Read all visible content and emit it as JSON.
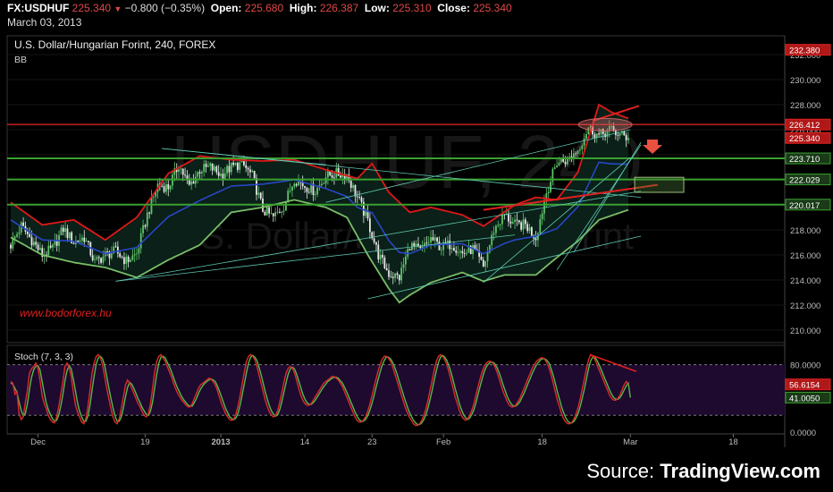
{
  "header": {
    "symbol": "FX:USDHUF",
    "last": "225.340",
    "change": "−0.800 (−0.35%)",
    "open_label": "Open:",
    "open": "225.680",
    "high_label": "High:",
    "high": "226.387",
    "low_label": "Low:",
    "low": "225.310",
    "close_label": "Close:",
    "close": "225.340",
    "date": "March 03, 2013"
  },
  "footer": {
    "source_label": "Source:",
    "source_name": "TradingView.com"
  },
  "colors": {
    "up_candle": "#5fc46a",
    "down_candle": "#e8e8e8",
    "bb_band": "#e01818",
    "bb_lower": "#7abe68",
    "bb_mid": "#2846c8",
    "fill": "#0a2018",
    "stoch_k": "#e02a2a",
    "stoch_d": "#55b84a",
    "stoch_bg": "#1e0a2e",
    "hline_red": "#d42020",
    "hline_green": "#3aa030",
    "trendline": "#5ec8b0"
  },
  "chart_data": [
    {
      "type": "candlestick",
      "title": "U.S. Dollar/Hungarian Forint, 240, FOREX",
      "indicator_label": "BB",
      "watermark": "USDHUF, 240",
      "watermark_sub": "U.S. Dollar/Hungarian Forint",
      "annotation": "www.bodorforex.hu",
      "ylim": [
        209,
        233.5
      ],
      "y_ticks": [
        "210.000",
        "212.000",
        "214.000",
        "216.000",
        "218.000",
        "220.000",
        "222.000",
        "224.000",
        "226.000",
        "228.000",
        "230.000",
        "232.000"
      ],
      "x_tick_labels": [
        "Dec",
        "19",
        "2013",
        "14",
        "23",
        "Feb",
        "18",
        "Mar",
        "18"
      ],
      "price_labels": [
        {
          "value": 232.38,
          "text": "232.380",
          "style": "red"
        },
        {
          "value": 226.412,
          "text": "226.412",
          "style": "red"
        },
        {
          "value": 225.34,
          "text": "225.340",
          "style": "red"
        },
        {
          "value": 223.71,
          "text": "223.710",
          "style": "green"
        },
        {
          "value": 222.029,
          "text": "222.029",
          "style": "green"
        },
        {
          "value": 220.017,
          "text": "220.017",
          "style": "green"
        }
      ],
      "horizontal_lines": [
        {
          "value": 226.412,
          "color": "red"
        },
        {
          "value": 223.71,
          "color": "green"
        },
        {
          "value": 222.029,
          "color": "green"
        },
        {
          "value": 220.017,
          "color": "green"
        }
      ],
      "close_anchors": [
        [
          0,
          216.8
        ],
        [
          5,
          218.3
        ],
        [
          10,
          217.2
        ],
        [
          15,
          216.0
        ],
        [
          20,
          216.5
        ],
        [
          25,
          218.1
        ],
        [
          30,
          217.0
        ],
        [
          35,
          217.4
        ],
        [
          40,
          215.4
        ],
        [
          45,
          216.0
        ],
        [
          50,
          216.3
        ],
        [
          55,
          215.5
        ],
        [
          60,
          216.1
        ],
        [
          65,
          219.2
        ],
        [
          70,
          221.6
        ],
        [
          75,
          221.4
        ],
        [
          80,
          223.2
        ],
        [
          85,
          221.5
        ],
        [
          90,
          222.8
        ],
        [
          95,
          223.0
        ],
        [
          100,
          222.4
        ],
        [
          105,
          223.0
        ],
        [
          110,
          223.3
        ],
        [
          115,
          222.3
        ],
        [
          120,
          219.6
        ],
        [
          125,
          219.0
        ],
        [
          130,
          219.9
        ],
        [
          135,
          222.1
        ],
        [
          140,
          221.5
        ],
        [
          145,
          221.1
        ],
        [
          150,
          222.3
        ],
        [
          155,
          222.5
        ],
        [
          160,
          222.4
        ],
        [
          165,
          220.6
        ],
        [
          170,
          218.7
        ],
        [
          175,
          216.0
        ],
        [
          180,
          214.5
        ],
        [
          185,
          214.2
        ],
        [
          190,
          216.8
        ],
        [
          195,
          216.3
        ],
        [
          200,
          217.3
        ],
        [
          205,
          216.6
        ],
        [
          210,
          216.9
        ],
        [
          215,
          216.1
        ],
        [
          220,
          216.5
        ],
        [
          225,
          215.0
        ],
        [
          230,
          218.0
        ],
        [
          235,
          219.2
        ],
        [
          240,
          218.4
        ],
        [
          245,
          218.4
        ],
        [
          250,
          217.4
        ],
        [
          255,
          221.0
        ],
        [
          260,
          223.4
        ],
        [
          265,
          223.6
        ],
        [
          270,
          224.4
        ],
        [
          275,
          226.2
        ],
        [
          280,
          225.5
        ],
        [
          285,
          226.0
        ],
        [
          290,
          225.6
        ],
        [
          294,
          225.34
        ]
      ],
      "bb_upper_anchors": [
        [
          0,
          220.2
        ],
        [
          15,
          218.4
        ],
        [
          30,
          218.8
        ],
        [
          45,
          217.2
        ],
        [
          60,
          219.0
        ],
        [
          75,
          222.5
        ],
        [
          90,
          223.9
        ],
        [
          105,
          223.6
        ],
        [
          120,
          223.5
        ],
        [
          135,
          223.6
        ],
        [
          150,
          222.8
        ],
        [
          165,
          222.1
        ],
        [
          172,
          223.3
        ],
        [
          180,
          221.0
        ],
        [
          190,
          219.4
        ],
        [
          200,
          219.8
        ],
        [
          215,
          219.2
        ],
        [
          225,
          218.3
        ],
        [
          240,
          220.0
        ],
        [
          250,
          220.6
        ],
        [
          260,
          220.4
        ],
        [
          270,
          222.6
        ],
        [
          280,
          228.0
        ],
        [
          286,
          227.4
        ],
        [
          294,
          226.9
        ]
      ],
      "bb_lower_anchors": [
        [
          0,
          217.4
        ],
        [
          15,
          216.0
        ],
        [
          30,
          215.4
        ],
        [
          45,
          215.0
        ],
        [
          60,
          214.2
        ],
        [
          75,
          215.6
        ],
        [
          90,
          216.8
        ],
        [
          105,
          219.4
        ],
        [
          120,
          219.8
        ],
        [
          135,
          220.4
        ],
        [
          150,
          219.8
        ],
        [
          160,
          219.0
        ],
        [
          170,
          216.0
        ],
        [
          180,
          213.3
        ],
        [
          185,
          212.2
        ],
        [
          190,
          212.8
        ],
        [
          200,
          213.8
        ],
        [
          215,
          214.6
        ],
        [
          225,
          213.9
        ],
        [
          235,
          214.4
        ],
        [
          250,
          214.4
        ],
        [
          260,
          215.8
        ],
        [
          270,
          217.1
        ],
        [
          280,
          218.8
        ],
        [
          294,
          219.6
        ]
      ]
    },
    {
      "type": "line",
      "title": "Stoch (7, 3, 3)",
      "ylim": [
        -2,
        103
      ],
      "y_ticks": [
        "0.0000",
        "80.0000"
      ],
      "levels": [
        20,
        80
      ],
      "last_values": [
        {
          "text": "56.6154",
          "value": 56.6154,
          "style": "red"
        },
        {
          "text": "41.0050",
          "value": 41.005,
          "style": "green"
        }
      ],
      "series": [
        {
          "name": "%K",
          "values": [
            60,
            58,
            45,
            48,
            22,
            15,
            18,
            35,
            50,
            70,
            75,
            78,
            82,
            77,
            62,
            44,
            34,
            28,
            20,
            15,
            12,
            11,
            18,
            30,
            45,
            60,
            78,
            82,
            76,
            66,
            48,
            32,
            24,
            18,
            12,
            10,
            16,
            30,
            50,
            70,
            82,
            90,
            92,
            88,
            80,
            66,
            52,
            40,
            28,
            18,
            12,
            10,
            16,
            28,
            42,
            56,
            62,
            58,
            52,
            46,
            40,
            34,
            30,
            24,
            20,
            18,
            22,
            34,
            52,
            72,
            84,
            90,
            92,
            88,
            84,
            78,
            72,
            66,
            58,
            52,
            46,
            42,
            38,
            35,
            32,
            30,
            30,
            34,
            40,
            46,
            52,
            56,
            58,
            60,
            62,
            64,
            63,
            60,
            56,
            50,
            42,
            34,
            28,
            22,
            18,
            15,
            14,
            16,
            22,
            32,
            44,
            58,
            72,
            84,
            90,
            92,
            90,
            86,
            78,
            68,
            58,
            48,
            38,
            30,
            24,
            20,
            18,
            20,
            26,
            36,
            48,
            60,
            70,
            76,
            78,
            76,
            70,
            62,
            52,
            44,
            38,
            34,
            32,
            32,
            34,
            38,
            42,
            46,
            50,
            54,
            58,
            60,
            62,
            64,
            66,
            66,
            64,
            62,
            58,
            54,
            48,
            42,
            36,
            30,
            24,
            18,
            14,
            12,
            12,
            14,
            18,
            24,
            32,
            42,
            52,
            62,
            72,
            80,
            86,
            90,
            90,
            88,
            84,
            78,
            70,
            62,
            54,
            46,
            38,
            30,
            24,
            18,
            14,
            10,
            8,
            8,
            10,
            14,
            20,
            28,
            38,
            50,
            62,
            74,
            84,
            90,
            92,
            90,
            86,
            80,
            72,
            62,
            52,
            42,
            34,
            26,
            20,
            16,
            14,
            16,
            20,
            26,
            34,
            44,
            54,
            64,
            72,
            78,
            82,
            84,
            84,
            82,
            78,
            72,
            64,
            56,
            48,
            42,
            36,
            32,
            30,
            30,
            32,
            36,
            40,
            46,
            52,
            58,
            64,
            70,
            76,
            80,
            84,
            86,
            88,
            88,
            86,
            82,
            76,
            68,
            58,
            48,
            38,
            30,
            22,
            16,
            12,
            10,
            10,
            12,
            16,
            22,
            30,
            40,
            52,
            64,
            76,
            86,
            92,
            90,
            86,
            80,
            74,
            68,
            62,
            56,
            50,
            44,
            40,
            38,
            38,
            40,
            44,
            50,
            56,
            60,
            56
          ]
        },
        {
          "name": "%D",
          "values": [
            58,
            57,
            52,
            47,
            36,
            26,
            19,
            22,
            34,
            51,
            65,
            74,
            78,
            79,
            74,
            61,
            47,
            35,
            27,
            21,
            16,
            13,
            14,
            20,
            31,
            45,
            61,
            73,
            79,
            75,
            63,
            49,
            35,
            25,
            18,
            13,
            13,
            19,
            32,
            50,
            67,
            81,
            88,
            90,
            87,
            79,
            66,
            53,
            40,
            29,
            19,
            13,
            13,
            18,
            29,
            42,
            53,
            59,
            57,
            52,
            46,
            40,
            35,
            29,
            25,
            21,
            20,
            25,
            36,
            53,
            69,
            82,
            89,
            90,
            88,
            83,
            78,
            72,
            65,
            58,
            52,
            47,
            42,
            38,
            35,
            32,
            31,
            31,
            35,
            40,
            46,
            51,
            55,
            58,
            60,
            62,
            63,
            62,
            60,
            55,
            49,
            42,
            35,
            28,
            23,
            18,
            16,
            15,
            17,
            23,
            33,
            45,
            58,
            71,
            82,
            89,
            91,
            89,
            85,
            77,
            68,
            58,
            48,
            39,
            31,
            25,
            21,
            19,
            21,
            27,
            37,
            48,
            59,
            69,
            75,
            77,
            75,
            69,
            61,
            53,
            45,
            39,
            35,
            33,
            33,
            35,
            38,
            42,
            46,
            50,
            54,
            57,
            60,
            62,
            64,
            65,
            65,
            64,
            61,
            58,
            53,
            48,
            42,
            36,
            30,
            24,
            19,
            15,
            13,
            13,
            15,
            19,
            25,
            33,
            42,
            52,
            62,
            71,
            79,
            85,
            89,
            89,
            87,
            83,
            77,
            70,
            62,
            54,
            46,
            38,
            31,
            24,
            19,
            14,
            11,
            9,
            9,
            11,
            15,
            21,
            29,
            39,
            50,
            62,
            73,
            83,
            89,
            91,
            89,
            85,
            79,
            71,
            62,
            52,
            43,
            34,
            27,
            21,
            17,
            15,
            17,
            21,
            27,
            35,
            45,
            55,
            64,
            72,
            78,
            81,
            83,
            83,
            81,
            77,
            71,
            64,
            56,
            49,
            42,
            37,
            33,
            31,
            31,
            33,
            36,
            41,
            46,
            52,
            58,
            64,
            70,
            75,
            80,
            83,
            86,
            87,
            87,
            85,
            82,
            75,
            67,
            58,
            48,
            39,
            30,
            23,
            17,
            13,
            11,
            11,
            13,
            17,
            23,
            31,
            41,
            52,
            64,
            76,
            85,
            89,
            89,
            85,
            80,
            74,
            68,
            62,
            56,
            50,
            45,
            41,
            39,
            39,
            41,
            45,
            50,
            55,
            58,
            41
          ]
        }
      ]
    }
  ]
}
